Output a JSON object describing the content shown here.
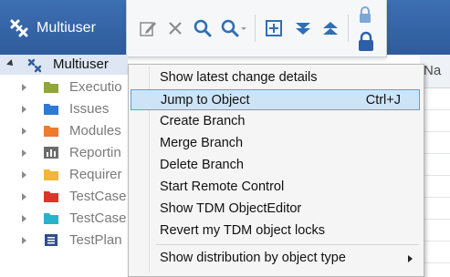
{
  "window": {
    "title": "Multiuser"
  },
  "toolbar": {
    "buttons": [
      "edit-icon",
      "delete-icon",
      "search-icon",
      "search-dropdown-icon",
      "add-icon",
      "collapse-down-icon",
      "expand-up-icon",
      "lock-icon",
      "lock-closed-icon"
    ]
  },
  "tree": {
    "root": {
      "label": "Multiuser"
    },
    "items": [
      {
        "label": "Executio",
        "color": "#8ea63b",
        "icon": "folder-icon"
      },
      {
        "label": "Issues",
        "color": "#2f78d4",
        "icon": "folder-icon"
      },
      {
        "label": "Modules",
        "color": "#f07a2e",
        "icon": "folder-icon"
      },
      {
        "label": "Reportin",
        "color": "#6b6b6b",
        "icon": "report-icon"
      },
      {
        "label": "Requirer",
        "color": "#f2b63a",
        "icon": "folder-icon"
      },
      {
        "label": "TestCase",
        "color": "#d9352b",
        "icon": "folder-icon"
      },
      {
        "label": "TestCase",
        "color": "#27b3c9",
        "icon": "folder-icon"
      },
      {
        "label": "TestPlan",
        "color": "#2f4e8c",
        "icon": "testplan-icon"
      }
    ]
  },
  "grid": {
    "header": "Na"
  },
  "context_menu": {
    "items": [
      {
        "label": "Show latest change details",
        "shortcut": ""
      },
      {
        "label": "Jump to Object",
        "shortcut": "Ctrl+J",
        "highlighted": true
      },
      {
        "label": "Create Branch",
        "shortcut": ""
      },
      {
        "label": "Merge Branch",
        "shortcut": ""
      },
      {
        "label": "Delete Branch",
        "shortcut": ""
      },
      {
        "label": "Start Remote Control",
        "shortcut": ""
      },
      {
        "label": "Show TDM ObjectEditor",
        "shortcut": ""
      },
      {
        "label": "Revert my TDM object locks",
        "shortcut": ""
      }
    ],
    "submenu_item": {
      "label": "Show distribution by object type"
    }
  },
  "colors": {
    "accent": "#2f5c9c",
    "highlight": "#cde4f7",
    "highlight_border": "#5ea0dc"
  }
}
